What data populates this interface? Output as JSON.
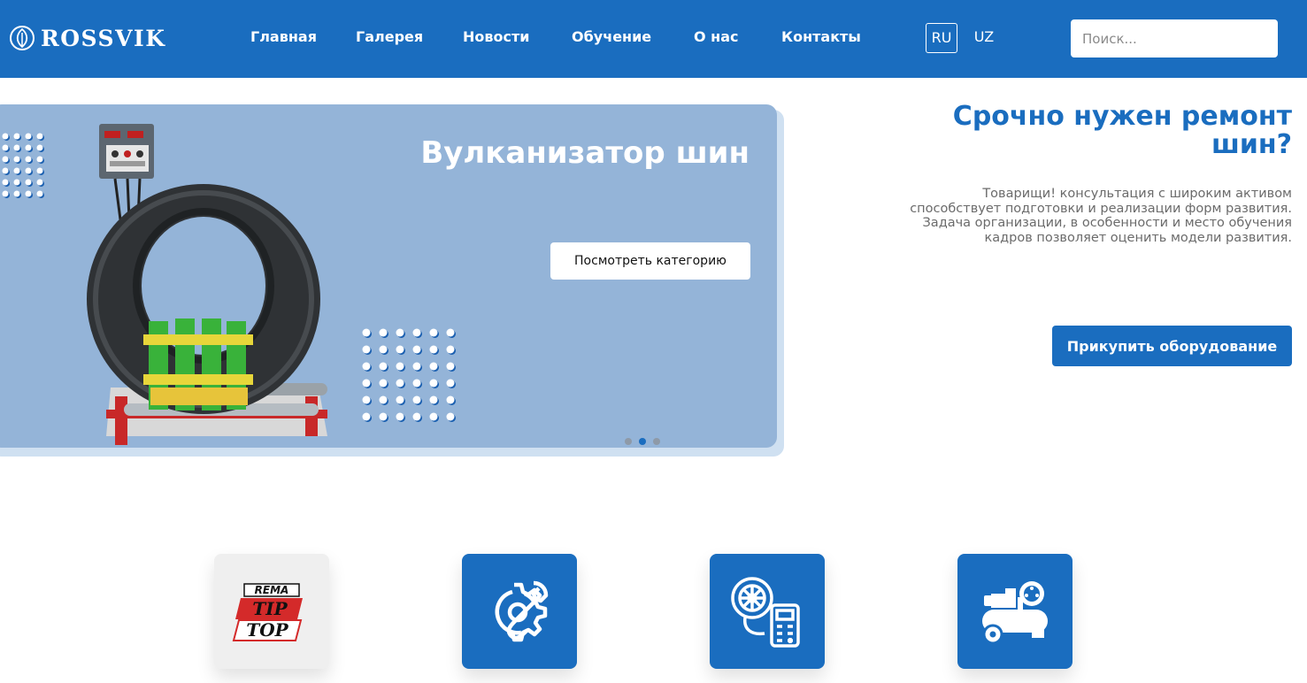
{
  "brand": {
    "name": "ROSSVIK",
    "logo_icon": "leaf-circle-icon"
  },
  "nav": [
    {
      "label": "Главная"
    },
    {
      "label": "Галерея"
    },
    {
      "label": "Новости"
    },
    {
      "label": "Обучение"
    },
    {
      "label": "О нас"
    },
    {
      "label": "Контакты"
    }
  ],
  "languages": {
    "active": "RU",
    "other": "UZ"
  },
  "search": {
    "placeholder": "Поиск..."
  },
  "slider": {
    "title": "Вулканизатор шин",
    "button_label": "Посмотреть категорию",
    "slide_count": 3,
    "active_slide": 2,
    "image_icon": "tire-vulcanizer-image"
  },
  "promo": {
    "title": "Срочно нужен ремонт шин?",
    "text": "Товарищи! консультация с широким активом способствует подготовки и реализации форм развития. Задача организации, в особенности и место обучения кадров позволяет оценить модели развития.",
    "button_label": "Прикупить оборудование"
  },
  "categories": [
    {
      "icon": "rema-tip-top-logo",
      "logo_text": [
        "REMA",
        "TIP",
        "TOP"
      ]
    },
    {
      "icon": "gear-wrench-icon"
    },
    {
      "icon": "wheel-balancer-icon"
    },
    {
      "icon": "air-compressor-icon"
    }
  ],
  "colors": {
    "primary": "#1a6dbf",
    "slider_bg": "#94b4d8",
    "text_gray": "#6b6b6b"
  }
}
